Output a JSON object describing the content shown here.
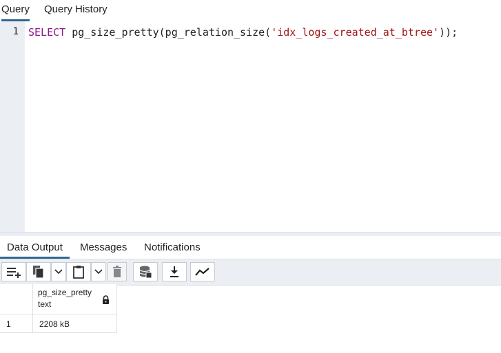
{
  "editor_tabs": [
    {
      "label": "Query",
      "active": true
    },
    {
      "label": "Query History",
      "active": false
    }
  ],
  "editor": {
    "line_numbers": [
      "1"
    ],
    "code": {
      "keyword": "SELECT",
      "function_open": " pg_size_pretty(pg_relation_size(",
      "string": "'idx_logs_created_at_btree'",
      "close": "));"
    }
  },
  "output_tabs": [
    {
      "label": "Data Output",
      "active": true
    },
    {
      "label": "Messages",
      "active": false
    },
    {
      "label": "Notifications",
      "active": false
    }
  ],
  "toolbar": {
    "icons": [
      "add-row-icon",
      "copy-icon",
      "chevron-down-icon",
      "paste-icon",
      "chevron-down-icon",
      "delete-icon",
      "save-data-icon",
      "download-icon",
      "graph-icon"
    ]
  },
  "grid": {
    "columns": [
      {
        "name": "pg_size_pretty",
        "type": "text",
        "locked": true
      }
    ],
    "rows": [
      {
        "row_number": "1",
        "values": [
          "2208 kB"
        ]
      }
    ]
  },
  "colors": {
    "accent": "#326690",
    "panel": "#ebeef3",
    "keyword": "#8b1a8a",
    "string": "#a31515"
  }
}
